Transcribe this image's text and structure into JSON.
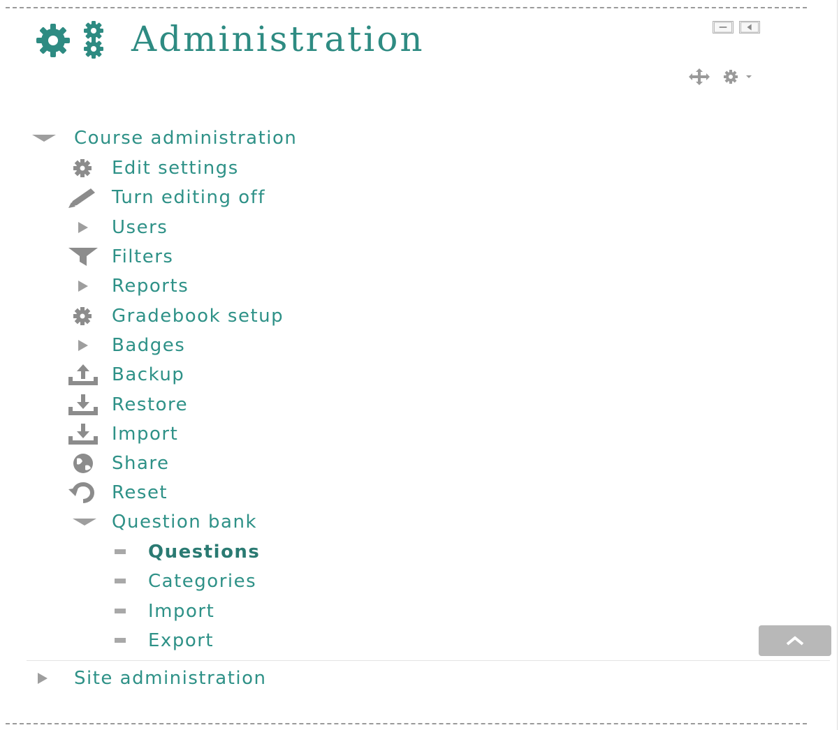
{
  "block": {
    "title": "Administration",
    "accent_color": "#2e8b82"
  },
  "course_admin": {
    "label": "Course administration",
    "items": [
      {
        "label": "Edit settings",
        "icon": "gear-icon"
      },
      {
        "label": "Turn editing off",
        "icon": "pencil-icon"
      },
      {
        "label": "Users",
        "icon": "caret-right-icon"
      },
      {
        "label": "Filters",
        "icon": "filter-icon"
      },
      {
        "label": "Reports",
        "icon": "caret-right-icon"
      },
      {
        "label": "Gradebook setup",
        "icon": "gear-icon"
      },
      {
        "label": "Badges",
        "icon": "caret-right-icon"
      },
      {
        "label": "Backup",
        "icon": "upload-tray-icon"
      },
      {
        "label": "Restore",
        "icon": "download-tray-icon"
      },
      {
        "label": "Import",
        "icon": "download-tray-icon"
      },
      {
        "label": "Share",
        "icon": "globe-icon"
      },
      {
        "label": "Reset",
        "icon": "reset-icon"
      }
    ]
  },
  "question_bank": {
    "label": "Question bank",
    "items": [
      {
        "label": "Questions",
        "icon": "bullet-icon",
        "current": true
      },
      {
        "label": "Categories",
        "icon": "bullet-icon"
      },
      {
        "label": "Import",
        "icon": "bullet-icon"
      },
      {
        "label": "Export",
        "icon": "bullet-icon"
      }
    ]
  },
  "site_admin": {
    "label": "Site administration"
  }
}
